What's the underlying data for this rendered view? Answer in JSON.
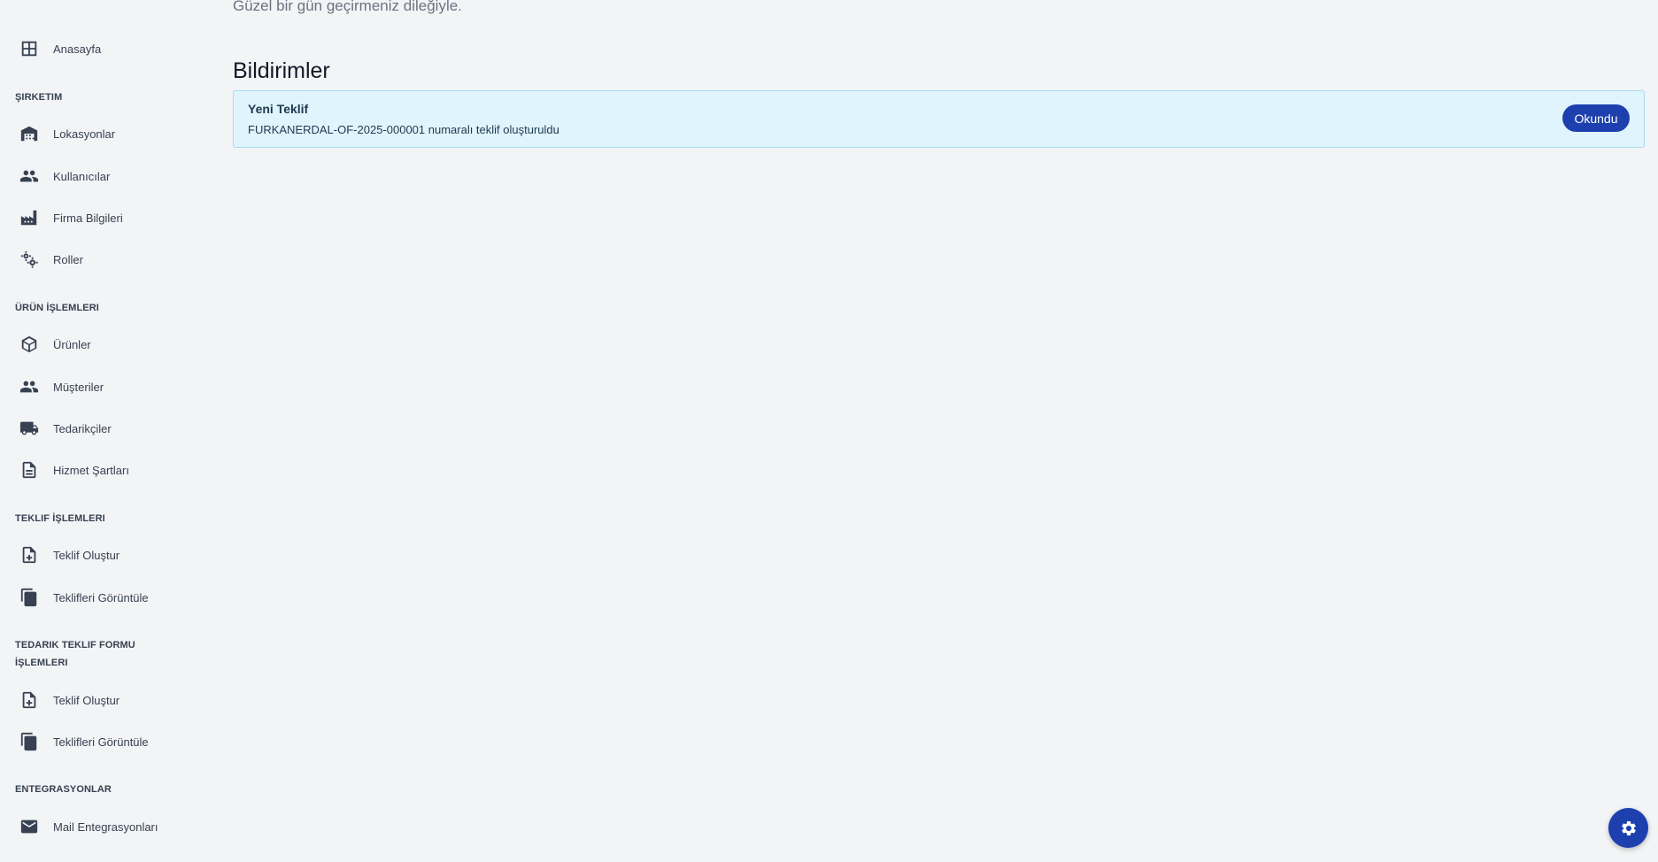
{
  "greeting": "Güzel bir gün geçirmeniz dileğiyle.",
  "page_title": "Bildirimler",
  "sidebar": {
    "home": {
      "label": "Anasayfa",
      "icon": "grid-icon"
    },
    "sections": [
      {
        "title": "ŞIRKETIM",
        "items": [
          {
            "label": "Lokasyonlar",
            "icon": "warehouse-icon"
          },
          {
            "label": "Kullanıcılar",
            "icon": "people-icon"
          },
          {
            "label": "Firma Bilgileri",
            "icon": "factory-icon"
          },
          {
            "label": "Roller",
            "icon": "gears-icon"
          }
        ]
      },
      {
        "title": "ÜRÜN İŞLEMLERI",
        "items": [
          {
            "label": "Ürünler",
            "icon": "box-icon"
          },
          {
            "label": "Müşteriler",
            "icon": "people-icon"
          },
          {
            "label": "Tedarikçiler",
            "icon": "truck-icon"
          },
          {
            "label": "Hizmet Şartları",
            "icon": "document-icon"
          }
        ]
      },
      {
        "title": "TEKLIF İŞLEMLERI",
        "items": [
          {
            "label": "Teklif Oluştur",
            "icon": "file-add-icon"
          },
          {
            "label": "Teklifleri Görüntüle",
            "icon": "files-icon"
          }
        ]
      },
      {
        "title": "TEDARIK TEKLIF FORMU İŞLEMLERI",
        "items": [
          {
            "label": "Teklif Oluştur",
            "icon": "file-add-icon"
          },
          {
            "label": "Teklifleri Görüntüle",
            "icon": "files-icon"
          }
        ]
      },
      {
        "title": "ENTEGRASYONLAR",
        "items": [
          {
            "label": "Mail Entegrasyonları",
            "icon": "mail-icon"
          }
        ]
      }
    ]
  },
  "notifications": [
    {
      "title": "Yeni Teklif",
      "message": "FURKANERDAL-OF-2025-000001 numaralı teklif oluşturuldu",
      "action_label": "Okundu"
    }
  ],
  "settings_fab": {
    "icon": "gear-icon"
  },
  "colors": {
    "background": "#f3f4f6",
    "accent": "#1e40af",
    "notification_bg": "#e0f4fd",
    "notification_border": "#a9dcf2"
  }
}
